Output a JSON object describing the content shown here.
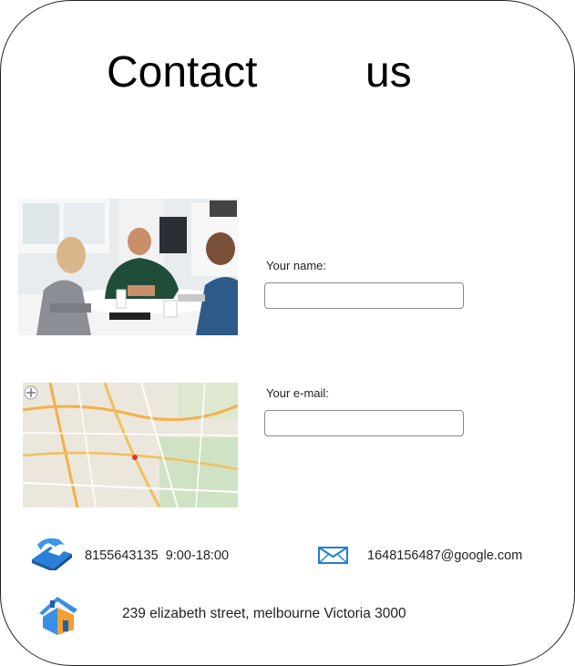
{
  "page": {
    "title_word_1": "Contact",
    "title_word_2": "us"
  },
  "form": {
    "name_label": "Your name:",
    "name_value": "",
    "email_label": "Your e-mail:",
    "email_value": ""
  },
  "contact": {
    "phone": "8155643135",
    "hours": "9:00-18:00",
    "email": "1648156487@google.com",
    "address": "239 elizabeth street, melbourne Victoria 3000"
  },
  "icons": {
    "phone": "telephone-icon",
    "email": "envelope-icon",
    "address": "house-icon"
  },
  "colors": {
    "accent_blue": "#1e7fd6",
    "house_roof": "#3a8ee6",
    "house_wall": "#f0a030"
  }
}
